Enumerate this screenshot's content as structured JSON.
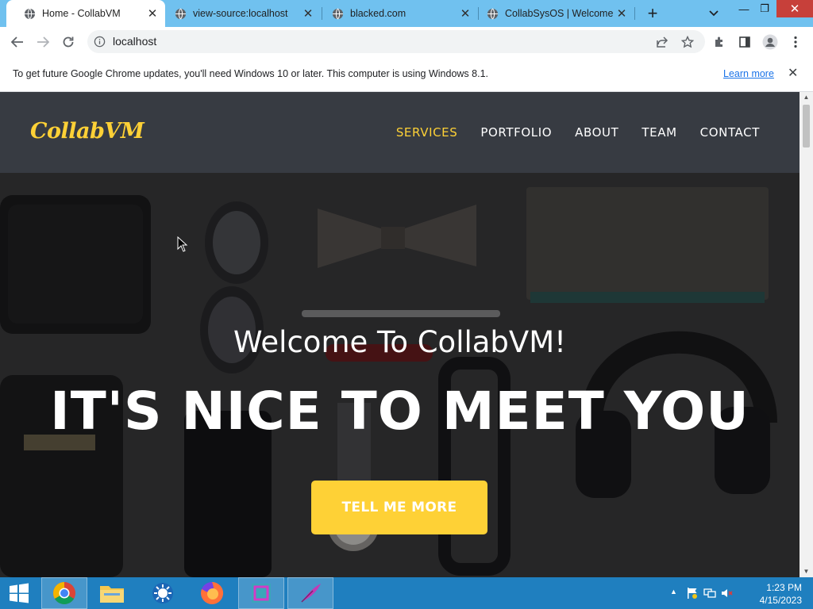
{
  "browser": {
    "tabs": [
      {
        "title": "Home - CollabVM",
        "active": true
      },
      {
        "title": "view-source:localhost",
        "active": false
      },
      {
        "title": "blacked.com",
        "active": false
      },
      {
        "title": "CollabSysOS | Welcome",
        "active": false
      }
    ],
    "new_tab_symbol": "+",
    "window_controls": {
      "minimize": "—",
      "restore": "❐",
      "close": "✕"
    },
    "address": "localhost",
    "icons": [
      "back-icon",
      "forward-icon",
      "reload-icon",
      "info-icon",
      "share-icon",
      "star-icon",
      "extensions-icon",
      "side-panel-icon",
      "profile-icon",
      "menu-icon"
    ]
  },
  "infobar": {
    "message": "To get future Google Chrome updates, you'll need Windows 10 or later. This computer is using Windows 8.1.",
    "link": "Learn more",
    "close": "✕"
  },
  "site": {
    "brand": "CollabVM",
    "nav": [
      {
        "label": "SERVICES",
        "active": true
      },
      {
        "label": "PORTFOLIO",
        "active": false
      },
      {
        "label": "ABOUT",
        "active": false
      },
      {
        "label": "TEAM",
        "active": false
      },
      {
        "label": "CONTACT",
        "active": false
      }
    ],
    "hero": {
      "subheading": "Welcome To CollabVM!",
      "heading": "IT'S NICE TO MEET YOU",
      "cta": "TELL ME MORE"
    },
    "colors": {
      "accent": "#fed136",
      "navbar": "#373b42"
    }
  },
  "taskbar": {
    "apps": [
      "windows-start-icon",
      "chrome-icon",
      "file-explorer-icon",
      "settings-sun-icon",
      "firefox-icon",
      "app-square-icon",
      "feather-app-icon"
    ],
    "time": "1:23 PM",
    "date": "4/15/2023"
  }
}
